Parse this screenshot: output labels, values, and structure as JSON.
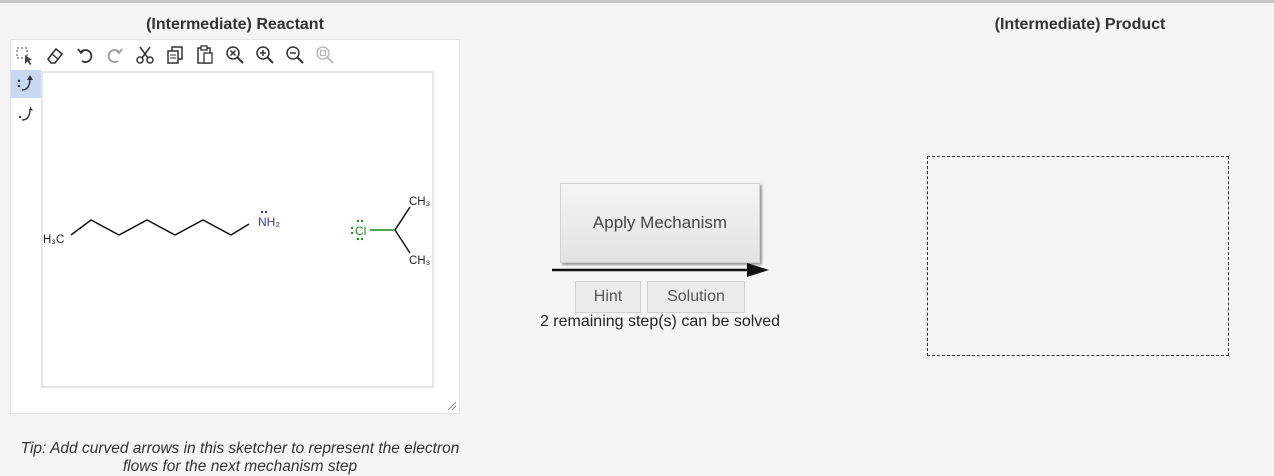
{
  "reactant_panel": {
    "title": "(Intermediate) Reactant",
    "toolbar": [
      {
        "name": "select-icon"
      },
      {
        "name": "eraser-icon"
      },
      {
        "name": "undo-icon"
      },
      {
        "name": "redo-icon"
      },
      {
        "name": "cut-icon"
      },
      {
        "name": "copy-icon"
      },
      {
        "name": "paste-icon"
      },
      {
        "name": "zoom-reset-icon"
      },
      {
        "name": "zoom-in-icon"
      },
      {
        "name": "zoom-out-icon"
      },
      {
        "name": "zoom-fit-icon"
      }
    ],
    "side_tools": [
      {
        "name": "electron-pair-arrow-icon",
        "active": true
      },
      {
        "name": "single-electron-arrow-icon",
        "active": false
      }
    ],
    "molecules": {
      "amine_methyl_label": "H₃C",
      "amine_group_label": "NH₂",
      "chloride_label": "Cl",
      "methyl_top_label": "CH₃",
      "methyl_bottom_label": "CH₃"
    },
    "tip": "Tip: Add curved arrows in this sketcher to represent the electron flows for the next mechanism step"
  },
  "controls": {
    "apply_label": "Apply Mechanism",
    "hint_label": "Hint",
    "solution_label": "Solution",
    "remaining_text": "2 remaining step(s) can be solved"
  },
  "product_panel": {
    "title": "(Intermediate) Product"
  },
  "colors": {
    "nitrogen": "#3b3b9c",
    "chlorine": "#1a8a1a",
    "active_tool_bg": "#c7d8f2"
  }
}
